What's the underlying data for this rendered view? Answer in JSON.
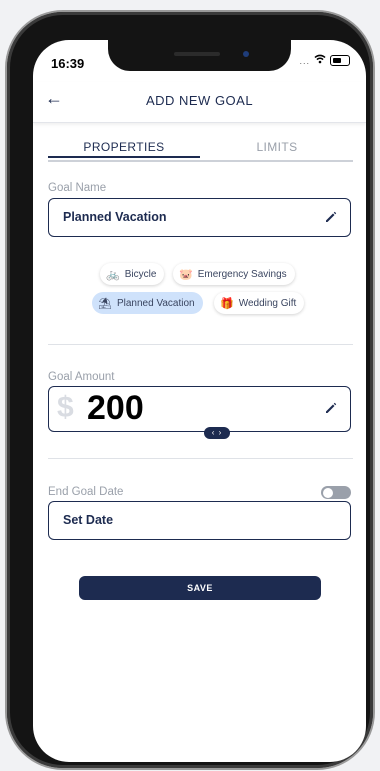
{
  "status_bar": {
    "time": "16:39",
    "more": "...",
    "icons": [
      "wifi-icon",
      "battery-icon"
    ]
  },
  "header": {
    "back_icon": "arrow-left-icon",
    "title": "ADD NEW GOAL"
  },
  "tabs": [
    {
      "label": "PROPERTIES",
      "active": true
    },
    {
      "label": "LIMITS",
      "active": false
    }
  ],
  "goal_name": {
    "label": "Goal Name",
    "value": "Planned Vacation",
    "edit_icon": "pencil-icon"
  },
  "suggestions": [
    {
      "label": "Bicycle",
      "icon": "bicycle-icon",
      "selected": false
    },
    {
      "label": "Emergency Savings",
      "icon": "piggy-bank-icon",
      "selected": false
    },
    {
      "label": "Planned Vacation",
      "icon": "beach-umbrella-icon",
      "selected": true
    },
    {
      "label": "Wedding Gift",
      "icon": "gift-icon",
      "selected": false
    }
  ],
  "goal_amount": {
    "label": "Goal Amount",
    "currency": "$",
    "value": "200",
    "edit_icon": "pencil-icon",
    "handle": "‹ ›"
  },
  "end_goal_date": {
    "label": "End Goal Date",
    "toggle_on": false,
    "value": "Set Date"
  },
  "save_label": "SAVE",
  "colors": {
    "primary": "#1d2b50",
    "selected_chip": "#cfe2fb",
    "muted": "#9aa0aa"
  }
}
